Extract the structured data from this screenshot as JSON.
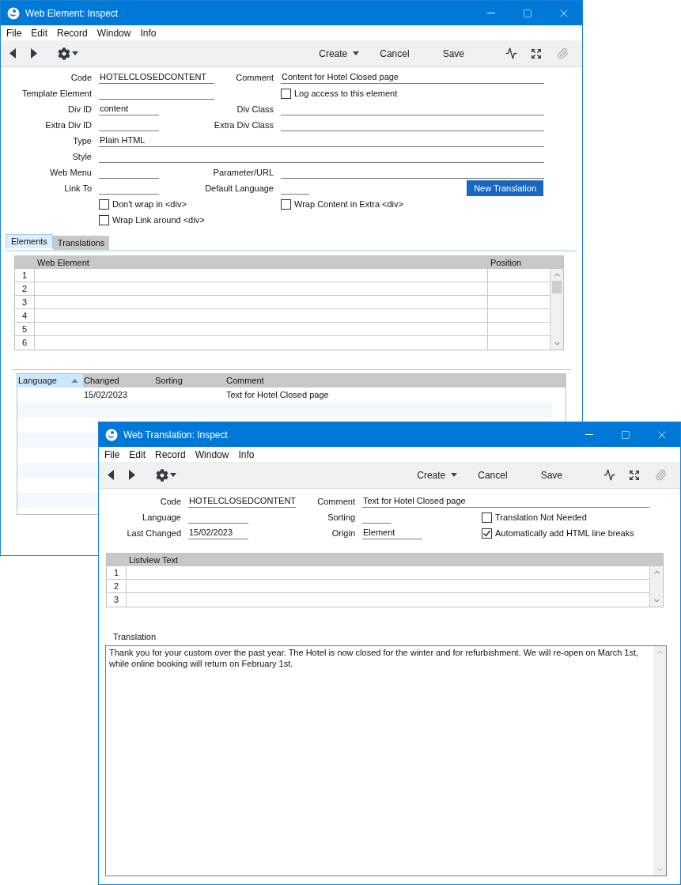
{
  "element_window": {
    "title": "Web Element: Inspect",
    "menu": [
      "File",
      "Edit",
      "Record",
      "Window",
      "Info"
    ],
    "toolbar": [
      {
        "label": "Create",
        "kind": "menu"
      },
      {
        "label": "Cancel",
        "kind": "button"
      },
      {
        "label": "Save",
        "kind": "button"
      }
    ],
    "form": [
      {
        "left": {
          "kind": "field",
          "label": "Code",
          "value": "HOTELCLOSEDCONTENT"
        },
        "right": {
          "kind": "field",
          "label": "Comment",
          "value": "Content for Hotel Closed page"
        }
      },
      {
        "left": {
          "kind": "field",
          "label": "Template Element"
        },
        "right": {
          "kind": "checkbox",
          "label": "Log access to this element",
          "checked": false
        }
      },
      {
        "left": {
          "kind": "field",
          "label": "Div ID",
          "value": "content"
        },
        "right": {
          "kind": "field",
          "label": "Div Class"
        }
      },
      {
        "left": {
          "kind": "field",
          "label": "Extra Div ID"
        },
        "right": {
          "kind": "field",
          "label": "Extra Div Class"
        }
      },
      {
        "left": {
          "kind": "wide",
          "label": "Type",
          "value": "Plain HTML"
        }
      },
      {
        "left": {
          "kind": "wide",
          "label": "Style"
        }
      },
      {
        "left": {
          "kind": "field",
          "label": "Web Menu"
        },
        "right": {
          "kind": "field",
          "label": "Parameter/URL"
        }
      },
      {
        "left": {
          "kind": "field",
          "label": "Link To"
        },
        "right": {
          "kind": "field",
          "label": "Default Language"
        },
        "button": "New Translation"
      },
      {
        "left": {
          "kind": "checkbox",
          "label": "Don't wrap in <div>",
          "checked": false
        },
        "right": {
          "kind": "checkbox",
          "label": "Wrap Content in Extra <div>",
          "checked": false
        }
      },
      {
        "left": {
          "kind": "checkbox",
          "label": "Wrap Link around <div>",
          "checked": false
        }
      }
    ],
    "tabs": [
      {
        "label": "Elements",
        "selected": true
      },
      {
        "label": "Translations",
        "selected": false
      }
    ],
    "matrix": {
      "columns": [
        "Web Element",
        "Position"
      ],
      "row_numbers": [
        "1",
        "2",
        "3",
        "4",
        "5",
        "6"
      ]
    },
    "list": {
      "columns": [
        {
          "label": "Language",
          "sorted": true
        },
        {
          "label": "Changed",
          "sorted": false
        },
        {
          "label": "Sorting",
          "sorted": false
        },
        {
          "label": "Comment",
          "sorted": false
        }
      ],
      "rows": [
        {
          "changed": "15/02/2023",
          "comment": "Text for Hotel Closed page"
        }
      ]
    }
  },
  "translation_window": {
    "title": "Web Translation: Inspect",
    "menu": [
      "File",
      "Edit",
      "Record",
      "Window",
      "Info"
    ],
    "toolbar": [
      {
        "label": "Create",
        "kind": "menu"
      },
      {
        "label": "Cancel",
        "kind": "button"
      },
      {
        "label": "Save",
        "kind": "button"
      }
    ],
    "form": [
      {
        "left": {
          "label": "Code",
          "value": "HOTELCLOSEDCONTENT"
        },
        "middle": {
          "label": "Comment",
          "value": "Text for Hotel Closed page"
        }
      },
      {
        "left": {
          "label": "Language"
        },
        "middle": {
          "label": "Sorting"
        },
        "right": {
          "label": "Translation Not Needed",
          "checked": false
        }
      },
      {
        "left": {
          "label": "Last Changed",
          "value": "15/02/2023"
        },
        "middle": {
          "label": "Origin",
          "value": "Element"
        },
        "right": {
          "label": "Automatically add HTML line breaks",
          "checked": true
        }
      }
    ],
    "matrix": {
      "columns": [
        "Listview Text"
      ],
      "row_numbers": [
        "1",
        "2",
        "3"
      ]
    },
    "translation": {
      "label": "Translation",
      "value": "Thank you for your custom over the past year. The Hotel is now closed for the winter and for refurbishment. We will re-open on March 1st, while online booking will return on February 1st."
    }
  }
}
